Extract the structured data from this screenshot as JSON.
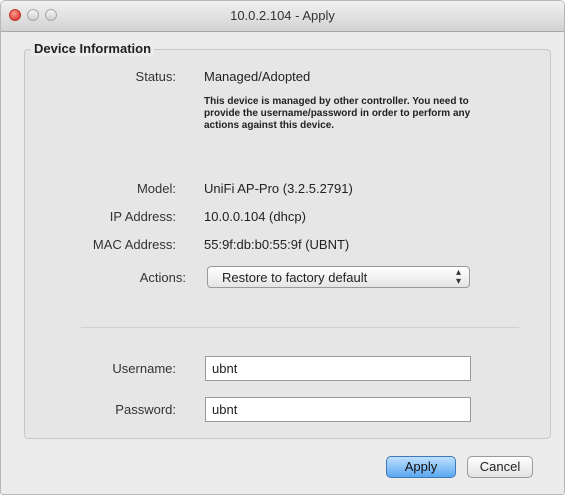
{
  "window": {
    "title": "10.0.2.104 - Apply"
  },
  "group": {
    "legend": "Device Information"
  },
  "fields": {
    "status_label": "Status:",
    "status_value": "Managed/Adopted",
    "status_note": "This device is managed by other controller. You need to provide the username/password in order to perform any actions against this device.",
    "model_label": "Model:",
    "model_value": "UniFi AP-Pro (3.2.5.2791)",
    "ip_label": "IP Address:",
    "ip_value": "10.0.0.104 (dhcp)",
    "mac_label": "MAC Address:",
    "mac_value": "55:9f:db:b0:55:9f (UBNT)",
    "actions_label": "Actions:",
    "actions_selected": "Restore to factory default",
    "username_label": "Username:",
    "username_value": "ubnt",
    "password_label": "Password:",
    "password_value": "ubnt"
  },
  "buttons": {
    "apply": "Apply",
    "cancel": "Cancel"
  },
  "icons": {
    "close": "close-icon",
    "minimize": "minimize-icon",
    "zoom": "zoom-icon",
    "select_arrows": "updown-arrows-icon"
  }
}
